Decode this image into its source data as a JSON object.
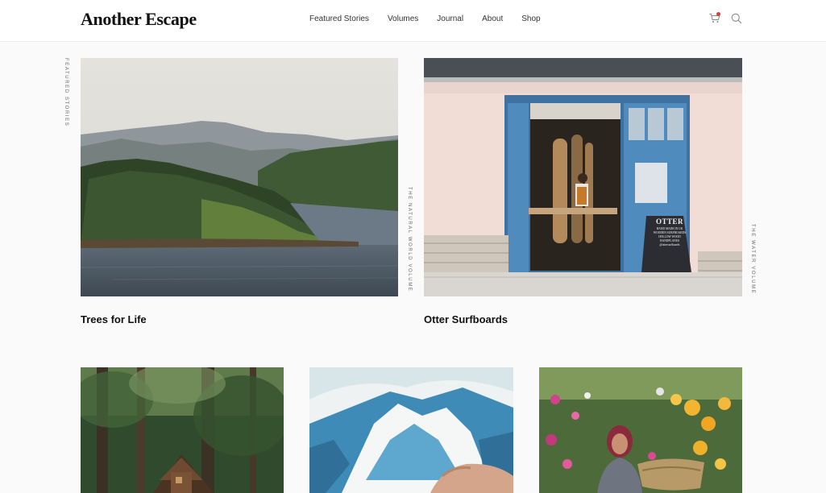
{
  "site": {
    "logo": "Another Escape"
  },
  "nav": {
    "items": [
      "Featured Stories",
      "Volumes",
      "Journal",
      "About",
      "Shop"
    ]
  },
  "header_icons": {
    "cart": "cart-icon",
    "search": "search-icon",
    "accent": "#e53935"
  },
  "side_labels": {
    "left": "Featured Stories",
    "card1": "The Natural World Volume",
    "card2": "The Water Volume"
  },
  "stories": [
    {
      "title": "Trees for Life",
      "image": "loch-forest-landscape"
    },
    {
      "title": "Otter Surfboards",
      "image": "surfboard-workshop"
    },
    {
      "title": "",
      "image": "forest-cabin"
    },
    {
      "title": "",
      "image": "mountain-painting"
    },
    {
      "title": "",
      "image": "flower-garden-portrait"
    }
  ],
  "shop_sign": {
    "brand": "OTTER",
    "lines": [
      "HAND MADE IN UK",
      "WOODEN SURFBOARDS",
      "HOLLOW WOOD",
      "HANDPLANES",
      "@ottersurfboards"
    ]
  }
}
